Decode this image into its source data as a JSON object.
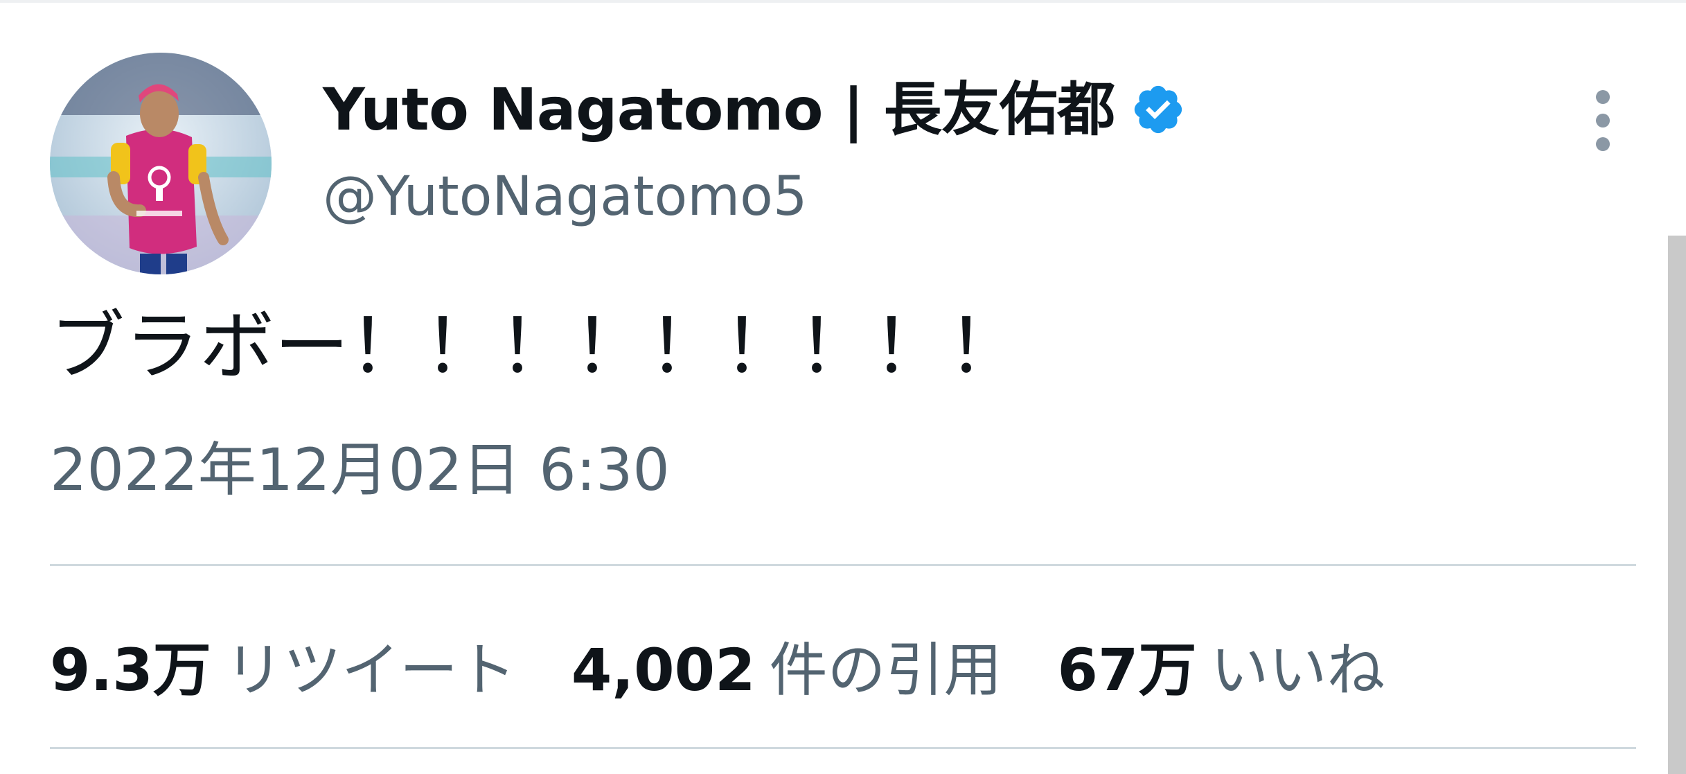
{
  "author": {
    "display_name": "Yuto Nagatomo | 長友佑都",
    "handle": "@YutoNagatomo5",
    "verified_icon": "verified-badge-icon",
    "avatar_icon": "avatar-photo"
  },
  "tweet": {
    "text": "ブラボー！！！！！！！！！",
    "timestamp": "2022年12月02日 6:30"
  },
  "stats": {
    "retweets": {
      "count": "9.3万",
      "label": "リツイート"
    },
    "quotes": {
      "count": "4,002",
      "label": "件の引用"
    },
    "likes": {
      "count": "67万",
      "label": "いいね"
    }
  },
  "menu": {
    "more_icon": "more-vertical-icon"
  },
  "colors": {
    "primary_text": "#0f1419",
    "secondary_text": "#536471",
    "verified_blue": "#1d9bf0",
    "divider": "#cfd9de"
  }
}
